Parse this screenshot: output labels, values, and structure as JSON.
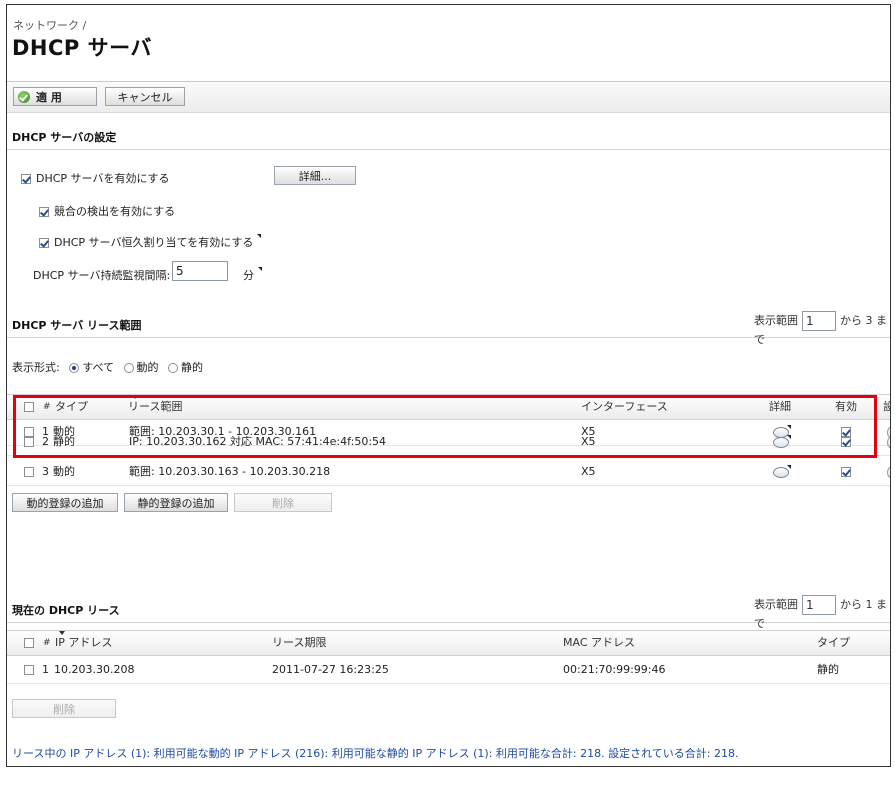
{
  "breadcrumb": "ネットワーク /",
  "title": "DHCP サーバ",
  "toolbar": {
    "apply_label": "適 用",
    "cancel_label": "キャンセル"
  },
  "settings": {
    "section_title": "DHCP サーバの設定",
    "enable_dhcp": {
      "label": "DHCP サーバを有効にする",
      "checked": true
    },
    "details_button": "詳細...",
    "conflict_detection": {
      "label": "競合の検出を有効にする",
      "checked": true
    },
    "persistent_assign": {
      "label": "DHCP サーバ恒久割り当てを有効にする",
      "checked": true
    },
    "monitor_interval": {
      "label": "DHCP サーバ持続監視間隔:",
      "value": "5",
      "unit": "分"
    }
  },
  "lease_scope": {
    "section_title": "DHCP サーバ リース範囲",
    "pager": {
      "label": "表示範囲",
      "value": "1",
      "suffix": "から 3 まで"
    },
    "view_mode_label": "表示形式:",
    "view_modes": [
      {
        "label": "すべて",
        "selected": true
      },
      {
        "label": "動的",
        "selected": false
      },
      {
        "label": "静的",
        "selected": false
      }
    ],
    "columns": {
      "num": "#",
      "type": "タイプ",
      "range": "リース範囲",
      "interface": "インターフェース",
      "details": "詳細",
      "enabled": "有効",
      "config": "設"
    },
    "rows": [
      {
        "num": "1",
        "type": "動的",
        "range": "範囲: 10.203.30.1 - 10.203.30.161",
        "interface": "X5",
        "enabled": true
      },
      {
        "num": "2",
        "type": "静的",
        "range": "IP: 10.203.30.162 対応 MAC: 57:41:4e:4f:50:54",
        "interface": "X5",
        "enabled": true
      },
      {
        "num": "3",
        "type": "動的",
        "range": "範囲: 10.203.30.163 - 10.203.30.218",
        "interface": "X5",
        "enabled": true
      }
    ],
    "buttons": {
      "add_dynamic": "動的登録の追加",
      "add_static": "静的登録の追加",
      "delete": "削除"
    }
  },
  "current_leases": {
    "section_title": "現在の DHCP リース",
    "pager": {
      "label": "表示範囲",
      "value": "1",
      "suffix": "から 1 まで"
    },
    "columns": {
      "num": "#",
      "ip": "IP アドレス",
      "expiry": "リース期限",
      "mac": "MAC アドレス",
      "type": "タイプ"
    },
    "rows": [
      {
        "num": "1",
        "ip": "10.203.30.208",
        "expiry": "2011-07-27 16:23:25",
        "mac": "00:21:70:99:99:46",
        "type": "静的"
      }
    ],
    "delete_button": "削除"
  },
  "footer_note": "リース中の IP アドレス (1): 利用可能な動的 IP アドレス (216): 利用可能な静的 IP アドレス (1): 利用可能な合計: 218. 設定されている合計: 218.",
  "colors": {
    "highlight": "#e3000f",
    "footer_text": "#1f4aa5"
  }
}
